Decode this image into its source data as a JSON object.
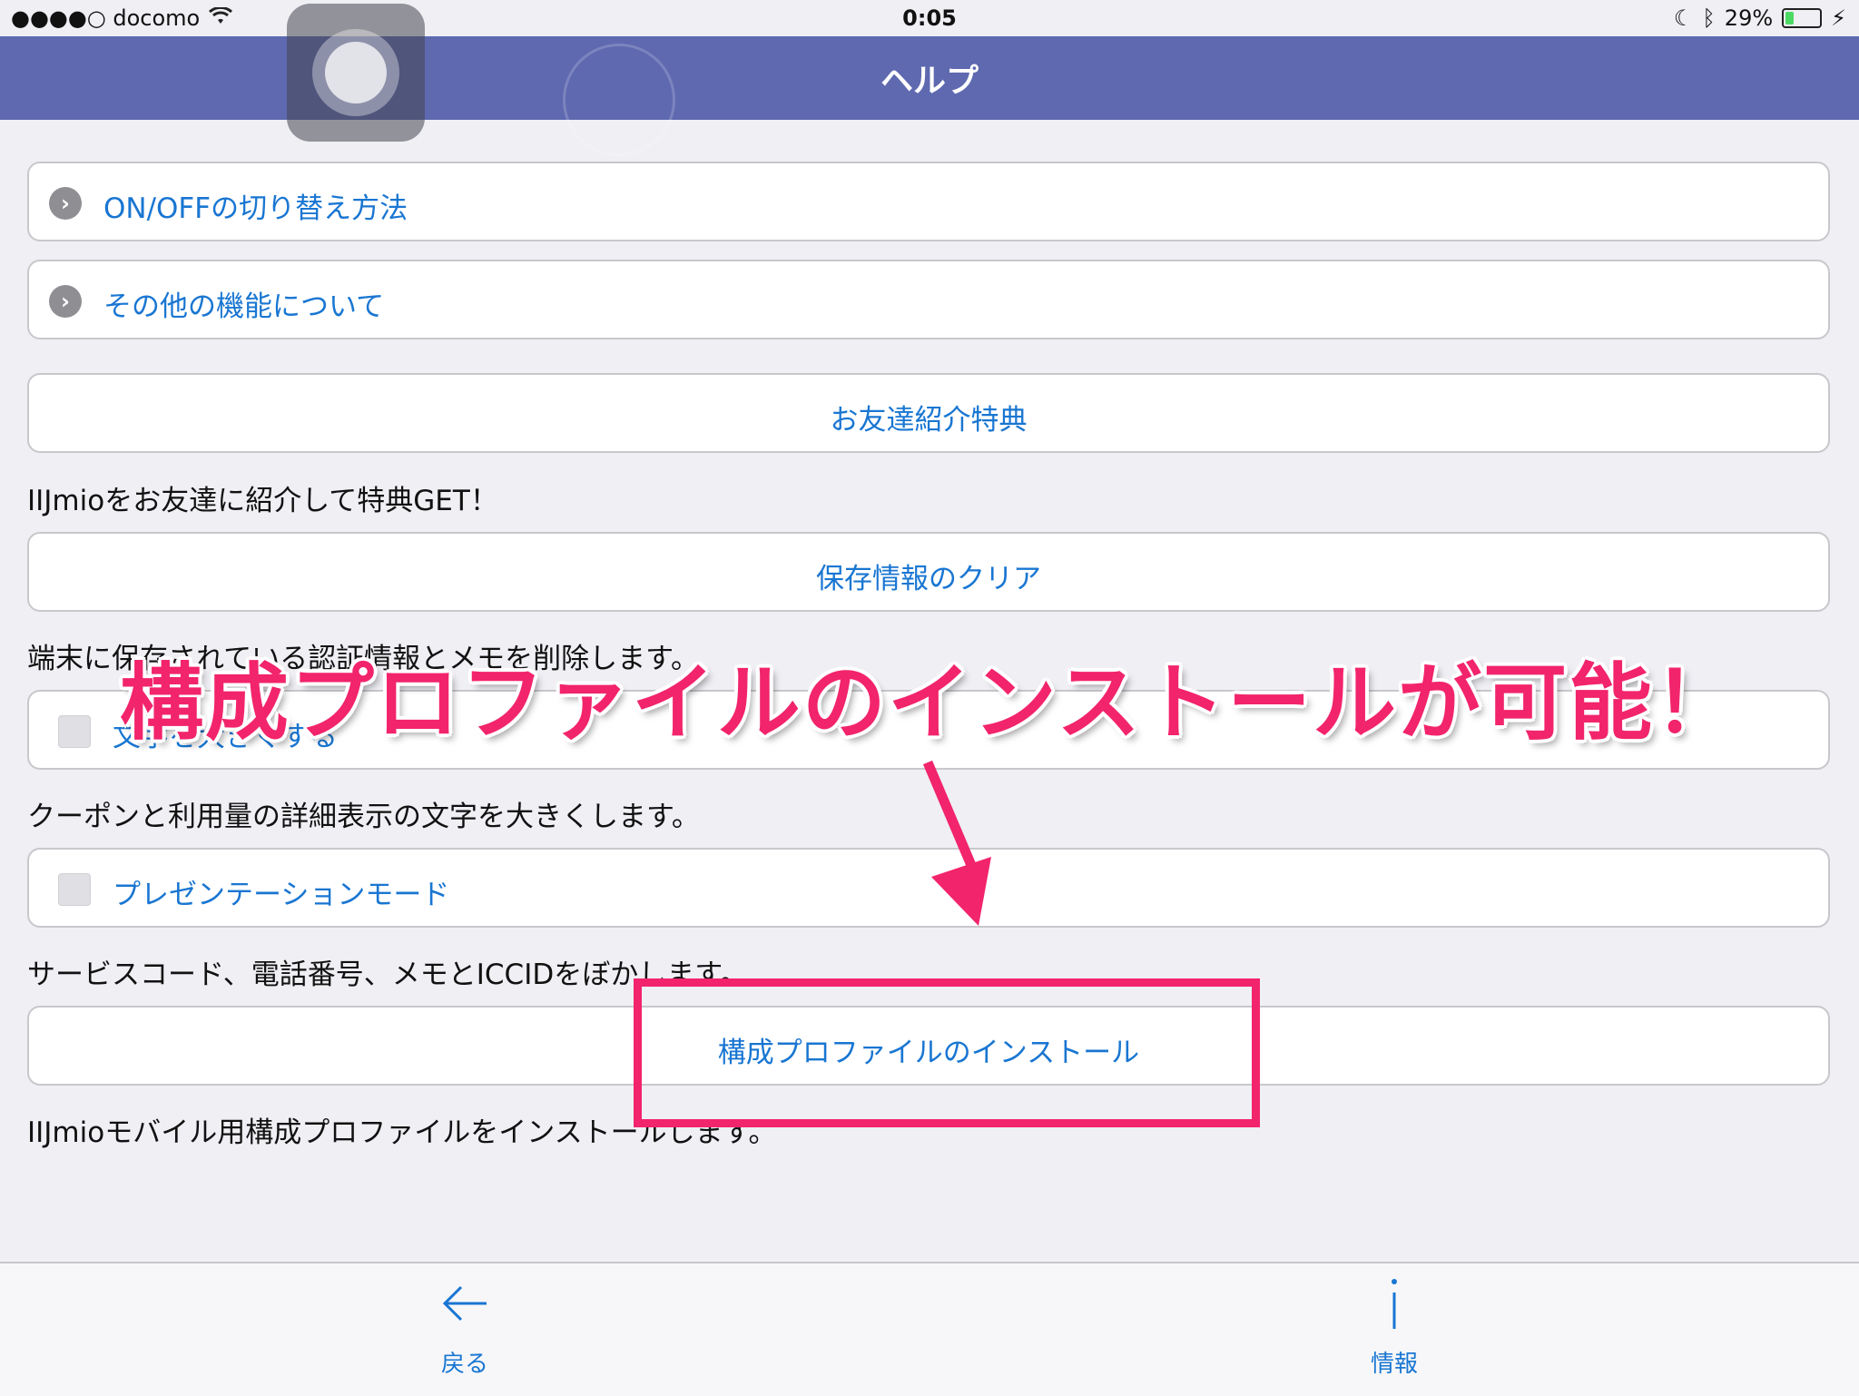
{
  "status": {
    "carrier": "●●●●○ docomo",
    "time": "0:05",
    "battery_text": "29%",
    "battery_level": 0.29
  },
  "nav": {
    "title": "ヘルプ"
  },
  "items": {
    "onoff": "ON/OFFの切り替え方法",
    "other": "その他の機能について",
    "referral": "お友達紹介特典",
    "referral_desc": "IIJmioをお友達に紹介して特典GET！",
    "clear": "保存情報のクリア",
    "clear_desc": "端末に保存されている認証情報とメモを削除します。",
    "bigtext": "文字を大きくする",
    "bigtext_desc": "クーポンと利用量の詳細表示の文字を大きくします。",
    "present": "プレゼンテーションモード",
    "present_desc": "サービスコード、電話番号、メモとICCIDをぼかします。",
    "profile": "構成プロファイルのインストール",
    "profile_desc": "IIJmioモバイル用構成プロファイルをインストールします。"
  },
  "tabs": {
    "back": "戻る",
    "info": "情報"
  },
  "annotation": {
    "headline": "構成プロファイルのインストールが可能！"
  },
  "colors": {
    "nav": "#5e69b0",
    "link": "#1976d2",
    "accent": "#f2246b"
  }
}
